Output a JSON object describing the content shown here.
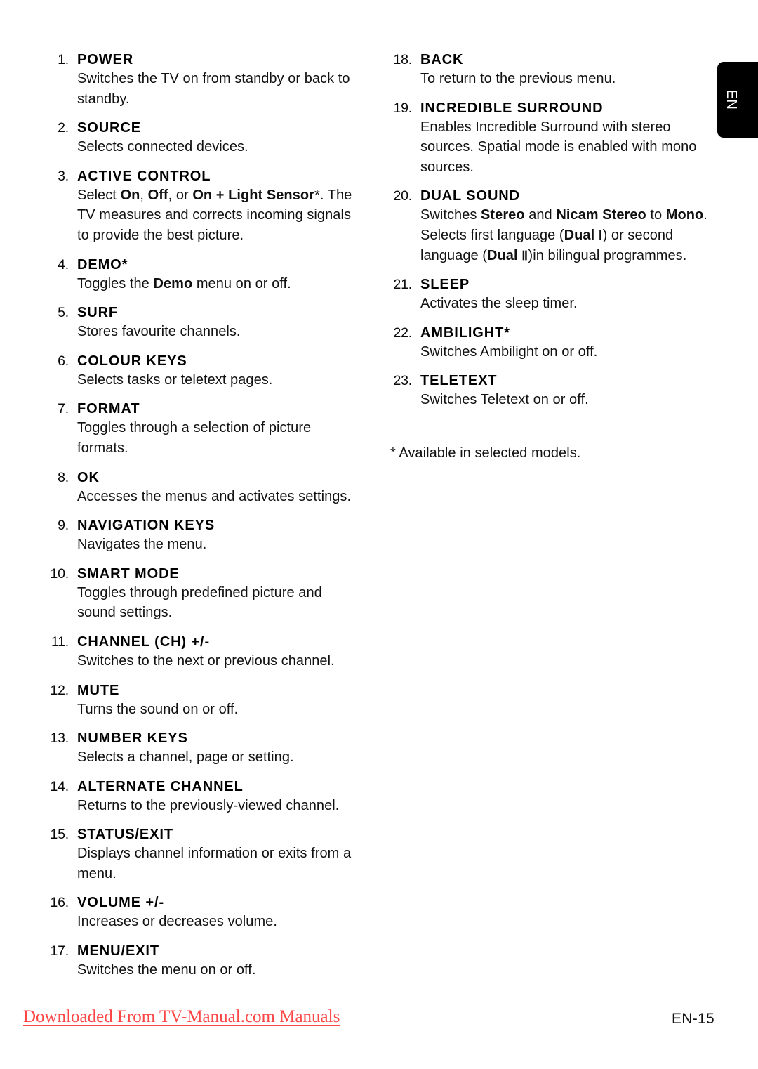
{
  "page": {
    "language_tab": "EN",
    "page_number": "EN-15",
    "download_notice": "Downloaded From TV-Manual.com Manuals",
    "footnote": "* Available in selected models.",
    "accent_red": "#fd4646",
    "text_color": "#000000"
  },
  "left_column": [
    {
      "num": "1.",
      "title": "POWER",
      "body": "Switches the TV on from standby or back to standby."
    },
    {
      "num": "2.",
      "title": "SOURCE",
      "body": "Selects connected devices."
    },
    {
      "num": "3.",
      "title": "ACTIVE CONTROL",
      "body_html": "Select <b>On</b>, <b>Off</b>, or <b>On + Light Sensor</b><span class=\"ast\">*</span>. The TV measures and corrects incoming signals to provide the best picture."
    },
    {
      "num": "4.",
      "title": "DEMO*",
      "body_html": "Toggles the <b>Demo</b> menu on or off."
    },
    {
      "num": "5.",
      "title": "SURF",
      "body": "Stores favourite channels."
    },
    {
      "num": "6.",
      "title": "COLOUR KEYS",
      "body": "Selects tasks or teletext pages."
    },
    {
      "num": "7.",
      "title": "FORMAT",
      "body": "Toggles through a selection of picture formats."
    },
    {
      "num": "8.",
      "title": "OK",
      "body": "Accesses the menus and activates settings."
    },
    {
      "num": "9.",
      "title": "NAVIGATION KEYS",
      "body": "Navigates the menu."
    },
    {
      "num": "10.",
      "title": "SMART MODE",
      "body": "Toggles through predefined picture and sound settings."
    },
    {
      "num": "11.",
      "title": "CHANNEL (CH) +/-",
      "body": "Switches to the next or previous channel."
    },
    {
      "num": "12.",
      "title": "MUTE",
      "body": "Turns the sound on or off."
    },
    {
      "num": "13.",
      "title": "NUMBER KEYS",
      "body": "Selects a channel, page or setting."
    },
    {
      "num": "14.",
      "title": "ALTERNATE CHANNEL",
      "body": "Returns to the previously-viewed channel."
    },
    {
      "num": "15.",
      "title": "STATUS/EXIT",
      "body": "Displays channel information or exits from a menu."
    },
    {
      "num": "16.",
      "title": "VOLUME +/-",
      "body": "Increases or decreases volume."
    },
    {
      "num": "17.",
      "title": "MENU/EXIT",
      "body": "Switches the menu on or off."
    }
  ],
  "right_column": [
    {
      "num": "18.",
      "title": "BACK",
      "body": "To return to the previous menu."
    },
    {
      "num": "19.",
      "title": "INCREDIBLE SURROUND",
      "body": "Enables Incredible Surround with stereo sources. Spatial mode is enabled with mono sources."
    },
    {
      "num": "20.",
      "title": "DUAL SOUND",
      "body_html": "Switches <b>Stereo</b> and <b>Nicam Stereo</b> to <b>Mono</b>. Selects first language (<b>Dual</b> <span class=\"rn\">Ⅰ</span>) or second language (<b>Dual</b> <span class=\"rn\">Ⅱ</span>)in bilingual programmes."
    },
    {
      "num": "21.",
      "title": "SLEEP",
      "body": "Activates the sleep timer."
    },
    {
      "num": "22.",
      "title": "AMBILIGHT*",
      "body": "Switches Ambilight on or off."
    },
    {
      "num": "23.",
      "title": "TELETEXT",
      "body": "Switches Teletext on or off."
    }
  ]
}
